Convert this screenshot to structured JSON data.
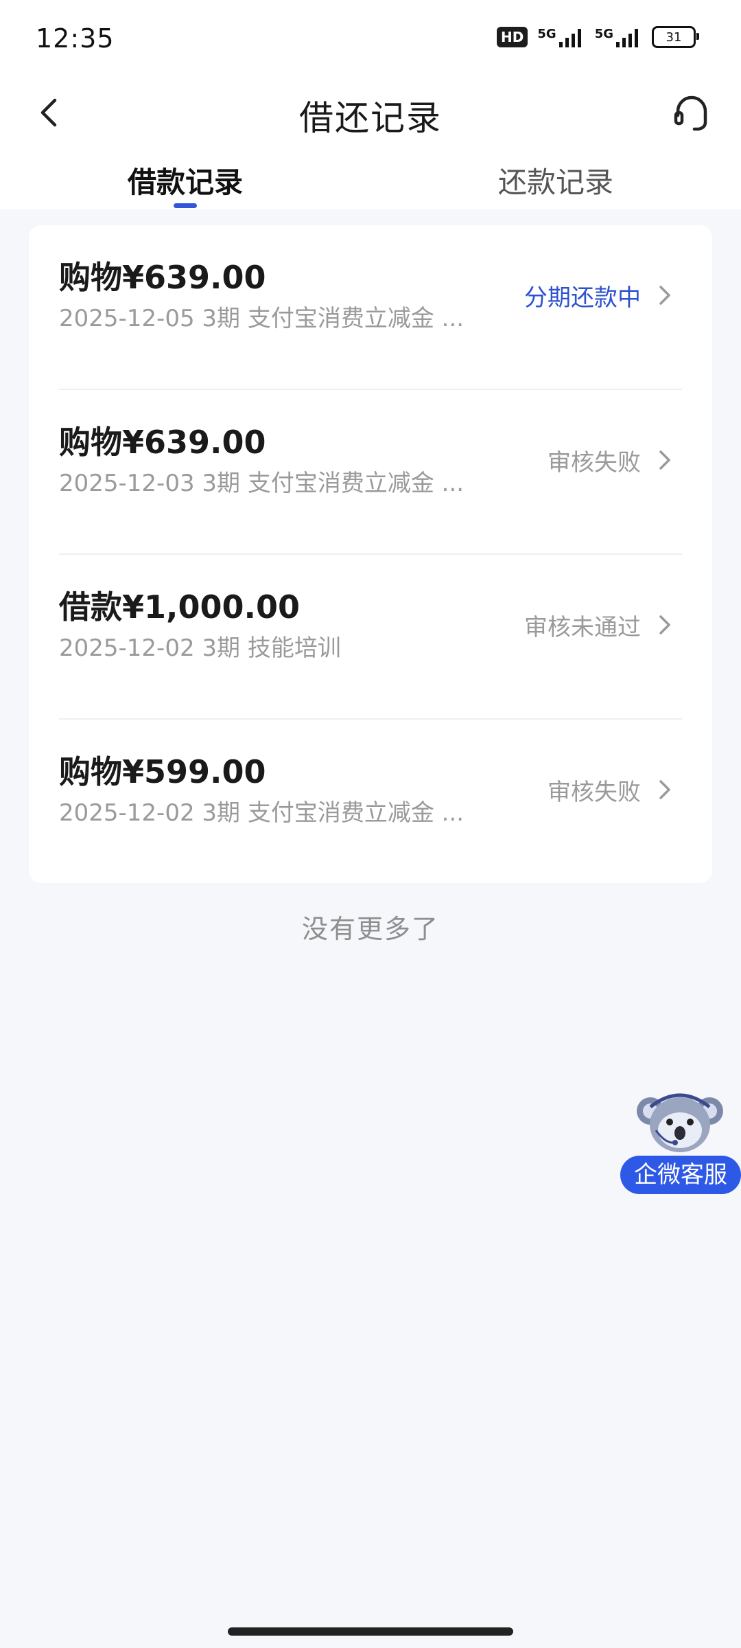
{
  "status_bar": {
    "time": "12:35",
    "hd_label": "HD",
    "signal1_label": "5G",
    "signal2_label": "5G",
    "battery_level": "31"
  },
  "header": {
    "title": "借还记录",
    "back_icon": "chevron-left-icon",
    "service_icon": "headset-icon"
  },
  "tabs": [
    {
      "label": "借款记录",
      "active": true
    },
    {
      "label": "还款记录",
      "active": false
    }
  ],
  "records": [
    {
      "amount": "购物¥639.00",
      "detail": "2025-12-05 3期  支付宝消费立减金 ...",
      "status": "分期还款中",
      "active": true
    },
    {
      "amount": "购物¥639.00",
      "detail": "2025-12-03 3期  支付宝消费立减金 ...",
      "status": "审核失败",
      "active": false
    },
    {
      "amount": "借款¥1,000.00",
      "detail": "2025-12-02 3期  技能培训",
      "status": "审核未通过",
      "active": false
    },
    {
      "amount": "购物¥599.00",
      "detail": "2025-12-02 3期  支付宝消费立减金 ...",
      "status": "审核失败",
      "active": false
    }
  ],
  "footer": {
    "no_more_text": "没有更多了"
  },
  "float_service": {
    "label": "企微客服",
    "icon": "koala-mascot-icon"
  },
  "colors": {
    "accent": "#2d52cf",
    "background": "#f6f7fb",
    "muted_text": "#9a9a9a"
  }
}
